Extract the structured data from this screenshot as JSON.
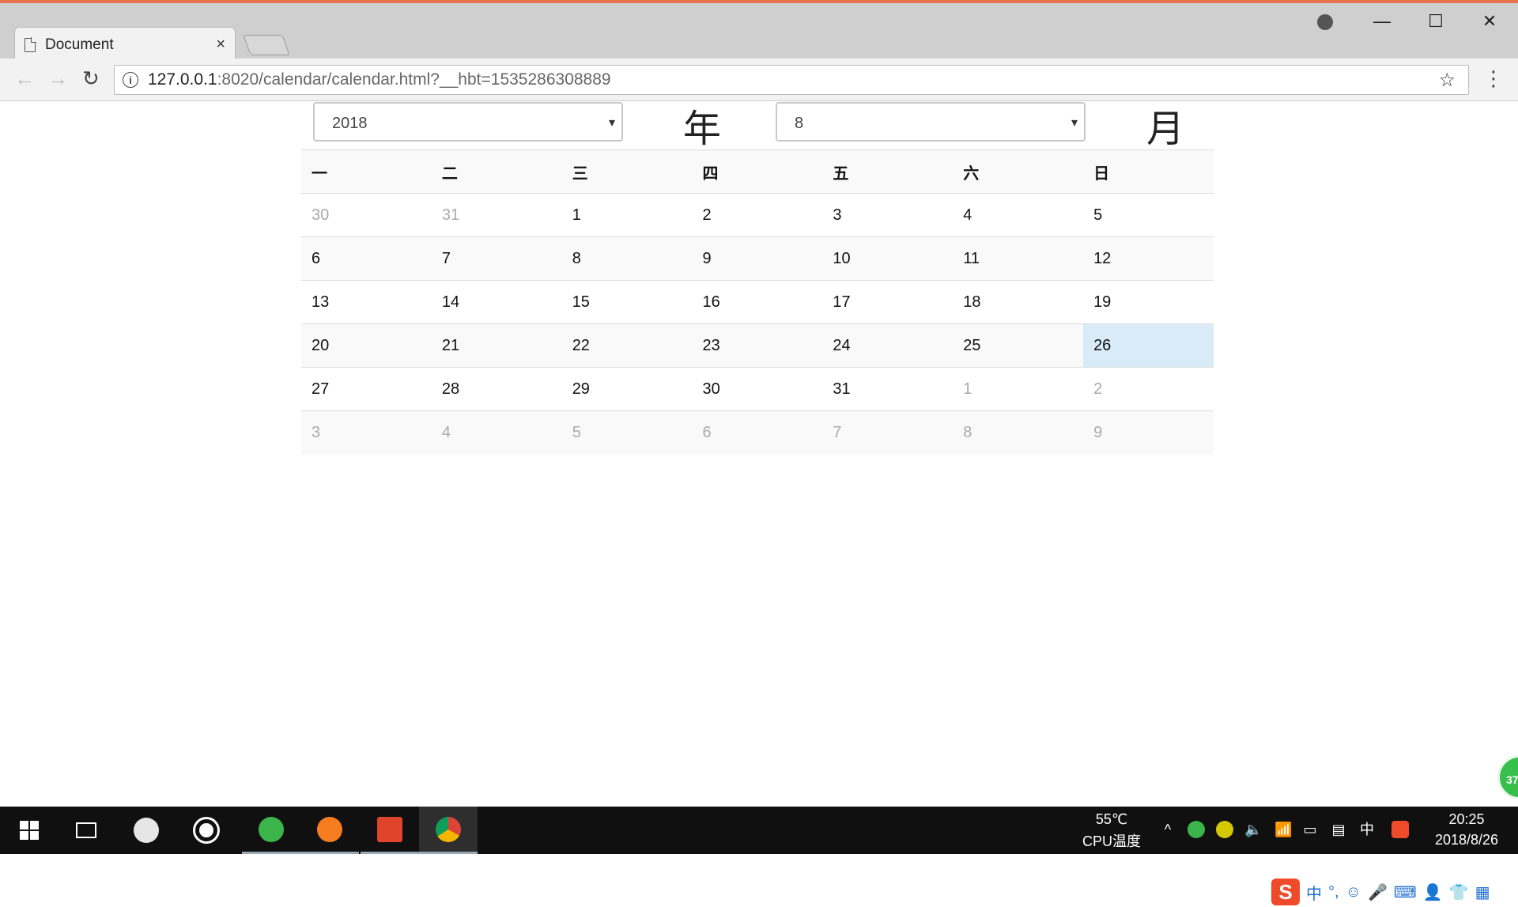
{
  "browser": {
    "tab_title": "Document",
    "tab_close": "×",
    "url_host": "127.0.0.1",
    "url_rest": ":8020/calendar/calendar.html?__hbt=1535286308889",
    "minimize": "—",
    "maximize": "☐",
    "close": "✕",
    "back": "←",
    "forward": "→",
    "reload": "↻",
    "info": "i",
    "star": "☆",
    "menu": "⋮"
  },
  "calendar": {
    "year_value": "2018",
    "year_label": "年",
    "month_value": "8",
    "month_label": "月",
    "caret": "▾",
    "weekdays": [
      "一",
      "二",
      "三",
      "四",
      "五",
      "六",
      "日"
    ],
    "weeks": [
      [
        {
          "d": "30",
          "m": true
        },
        {
          "d": "31",
          "m": true
        },
        {
          "d": "1"
        },
        {
          "d": "2"
        },
        {
          "d": "3"
        },
        {
          "d": "4"
        },
        {
          "d": "5"
        }
      ],
      [
        {
          "d": "6"
        },
        {
          "d": "7"
        },
        {
          "d": "8"
        },
        {
          "d": "9"
        },
        {
          "d": "10"
        },
        {
          "d": "11"
        },
        {
          "d": "12"
        }
      ],
      [
        {
          "d": "13"
        },
        {
          "d": "14"
        },
        {
          "d": "15"
        },
        {
          "d": "16"
        },
        {
          "d": "17"
        },
        {
          "d": "18"
        },
        {
          "d": "19"
        }
      ],
      [
        {
          "d": "20"
        },
        {
          "d": "21"
        },
        {
          "d": "22"
        },
        {
          "d": "23"
        },
        {
          "d": "24"
        },
        {
          "d": "25"
        },
        {
          "d": "26",
          "today": true
        }
      ],
      [
        {
          "d": "27"
        },
        {
          "d": "28"
        },
        {
          "d": "29"
        },
        {
          "d": "30"
        },
        {
          "d": "31"
        },
        {
          "d": "1",
          "m": true
        },
        {
          "d": "2",
          "m": true
        }
      ],
      [
        {
          "d": "3",
          "m": true
        },
        {
          "d": "4",
          "m": true
        },
        {
          "d": "5",
          "m": true
        },
        {
          "d": "6",
          "m": true
        },
        {
          "d": "7",
          "m": true
        },
        {
          "d": "8",
          "m": true
        },
        {
          "d": "9",
          "m": true
        }
      ]
    ]
  },
  "overlay": {
    "badge": "37",
    "ime_logo": "S",
    "ime_items": [
      "中",
      "°,",
      "☺",
      "🎤",
      "⌨",
      "👤",
      "👕",
      "▦"
    ]
  },
  "taskbar": {
    "cpu_temp": "55℃",
    "cpu_label": "CPU温度",
    "tray_chevron": "^",
    "tray_volume": "🔈",
    "tray_network": "📶",
    "tray_battery": "▭",
    "tray_action": "▤",
    "ime_mode": "中",
    "time": "20:25",
    "date": "2018/8/26"
  }
}
